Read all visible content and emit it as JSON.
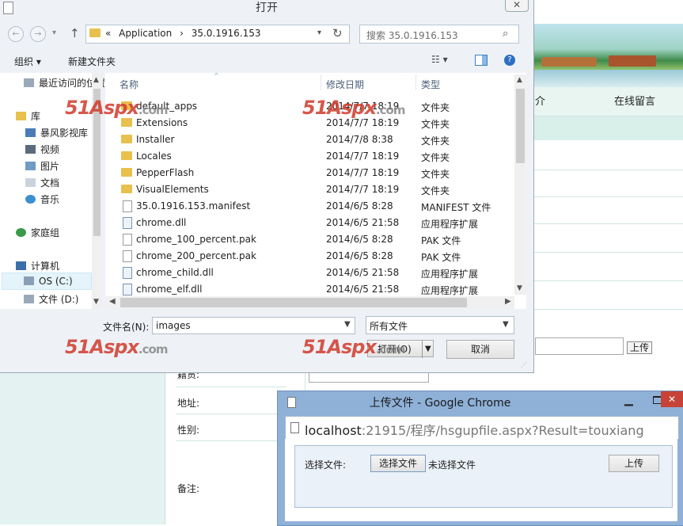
{
  "webpage": {
    "nav_left": "介",
    "nav_right": "在线留言",
    "upload_label": "上传",
    "rows": [
      "籍贯:",
      "地址:",
      "性别:",
      "备注:"
    ]
  },
  "dialog": {
    "title": "打开",
    "close": "✕",
    "nav": {
      "back": "←",
      "forward": "→",
      "dropdown": "▾",
      "up": "↑"
    },
    "address": {
      "prefix": "«",
      "segments": [
        "Application",
        "35.0.1916.153"
      ],
      "sep": "›"
    },
    "refresh": "↻",
    "search_placeholder": "搜索 35.0.1916.153",
    "toolbar": {
      "organize": "组织 ▾",
      "new_folder": "新建文件夹",
      "view": "☷ ▾",
      "help": "?"
    },
    "sidebar": [
      {
        "label": "最近访问的位置",
        "icon": "recent-icon"
      },
      {
        "label": "库",
        "icon": "library-icon"
      },
      {
        "label": "暴风影视库",
        "icon": "video-library-icon"
      },
      {
        "label": "视频",
        "icon": "video-icon"
      },
      {
        "label": "图片",
        "icon": "picture-icon"
      },
      {
        "label": "文档",
        "icon": "document-icon"
      },
      {
        "label": "音乐",
        "icon": "music-icon"
      },
      {
        "label": "家庭组",
        "icon": "homegroup-icon"
      },
      {
        "label": "计算机",
        "icon": "computer-icon"
      },
      {
        "label": "OS (C:)",
        "icon": "drive-icon"
      },
      {
        "label": "文件 (D:)",
        "icon": "drive-icon"
      }
    ],
    "columns": {
      "name": "名称",
      "date": "修改日期",
      "type": "类型"
    },
    "files": [
      {
        "name": "default_apps",
        "date": "2014/7/7 18:19",
        "type": "文件夹",
        "kind": "folder"
      },
      {
        "name": "Extensions",
        "date": "2014/7/7 18:19",
        "type": "文件夹",
        "kind": "folder"
      },
      {
        "name": "Installer",
        "date": "2014/7/8 8:38",
        "type": "文件夹",
        "kind": "folder"
      },
      {
        "name": "Locales",
        "date": "2014/7/7 18:19",
        "type": "文件夹",
        "kind": "folder"
      },
      {
        "name": "PepperFlash",
        "date": "2014/7/7 18:19",
        "type": "文件夹",
        "kind": "folder"
      },
      {
        "name": "VisualElements",
        "date": "2014/7/7 18:19",
        "type": "文件夹",
        "kind": "folder"
      },
      {
        "name": "35.0.1916.153.manifest",
        "date": "2014/6/5 8:28",
        "type": "MANIFEST 文件",
        "kind": "doc"
      },
      {
        "name": "chrome.dll",
        "date": "2014/6/5 21:58",
        "type": "应用程序扩展",
        "kind": "dll"
      },
      {
        "name": "chrome_100_percent.pak",
        "date": "2014/6/5 8:28",
        "type": "PAK 文件",
        "kind": "doc"
      },
      {
        "name": "chrome_200_percent.pak",
        "date": "2014/6/5 8:28",
        "type": "PAK 文件",
        "kind": "doc"
      },
      {
        "name": "chrome_child.dll",
        "date": "2014/6/5 21:58",
        "type": "应用程序扩展",
        "kind": "dll"
      },
      {
        "name": "chrome_elf.dll",
        "date": "2014/6/5 21:58",
        "type": "应用程序扩展",
        "kind": "dll"
      }
    ],
    "filename_label": "文件名(N):",
    "filename_value": "images",
    "filetype_value": "所有文件",
    "open_button": "打开(O)",
    "cancel_button": "取消",
    "watermark": {
      "main": "51Aspx",
      "suffix": ".com"
    }
  },
  "chrome_popup": {
    "title": "上传文件 - Google Chrome",
    "url_host": "localhost",
    "url_rest": ":21915/程序/hsgupfile.aspx?Result=touxiang",
    "choose_label": "选择文件:",
    "choose_button": "选择文件",
    "no_file": "未选择文件",
    "upload_button": "上传",
    "close": "✕",
    "minimize": "▁"
  }
}
